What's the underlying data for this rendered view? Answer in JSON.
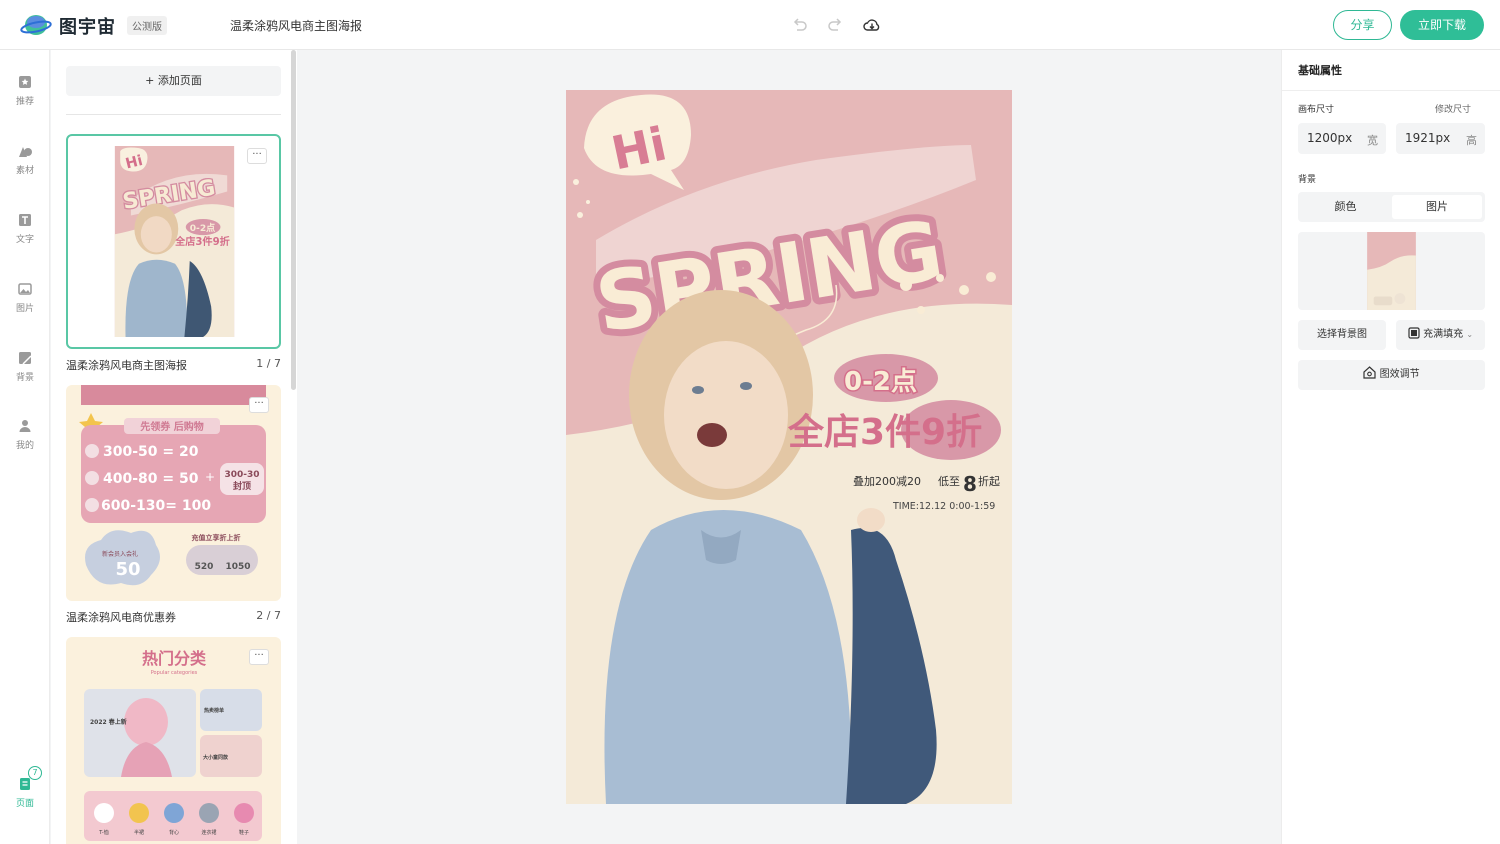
{
  "header": {
    "brand": "图宇宙",
    "badge": "公测版",
    "doc_title": "温柔涂鸦风电商主图海报",
    "share_label": "分享",
    "download_label": "立即下载"
  },
  "rail": {
    "items": [
      {
        "label": "推荐",
        "icon": "recommend-icon"
      },
      {
        "label": "素材",
        "icon": "shapes-icon"
      },
      {
        "label": "文字",
        "icon": "text-icon"
      },
      {
        "label": "图片",
        "icon": "image-icon"
      },
      {
        "label": "背景",
        "icon": "background-icon"
      },
      {
        "label": "我的",
        "icon": "user-icon"
      }
    ],
    "pages": {
      "label": "页面",
      "count": "7"
    }
  },
  "panel": {
    "add_page_label": "+ 添加页面",
    "pages": [
      {
        "caption": "温柔涂鸦风电商主图海报",
        "num": "1 / 7"
      },
      {
        "caption": "温柔涂鸦风电商优惠券",
        "num": "2 / 7"
      }
    ],
    "thumb1": {
      "hi": "Hi",
      "spring": "SPRING",
      "time": "0-2点",
      "offer": "全店3件9折"
    },
    "thumb2": {
      "ribbon": "先领券 后购物",
      "coupons": [
        "300-50 = 20",
        "400-80 = 50",
        "600-130= 100"
      ],
      "plus": "+",
      "cap": "300-30",
      "cap2": "封顶",
      "member": "新会员入会礼",
      "member_val": "50",
      "recharge": "充值立享折上折",
      "r1": "520",
      "r2": "1050"
    },
    "thumb3": {
      "title": "热门分类",
      "subtitle": "Popular categories",
      "tag": "2022 春上新",
      "tag2": "热卖榜单",
      "tag3": "大小童同款",
      "items": [
        "T-恤",
        "半裙",
        "背心",
        "连衣裙",
        "鞋子"
      ]
    }
  },
  "poster": {
    "hi": "Hi",
    "spring": "SPRING",
    "time": "0-2点",
    "offer": "全店3件9折",
    "stack": "叠加200减20",
    "low_prefix": "低至",
    "low_num": "8",
    "low_suffix": "折起",
    "time_range": "TIME:12.12 0:00-1:59"
  },
  "props": {
    "title": "基础属性",
    "canvas_size_label": "画布尺寸",
    "resize_label": "修改尺寸",
    "width_value": "1200px",
    "width_unit": "宽",
    "height_value": "1921px",
    "height_unit": "高",
    "bg_label": "背景",
    "tab_color": "颜色",
    "tab_image": "图片",
    "choose_bg_label": "选择背景图",
    "fill_label": "充满填充",
    "effect_label": "图效调节"
  },
  "colors": {
    "accent": "#2fbe97",
    "poster_pink": "#e6b8b8",
    "spring_pink": "#d98a9c",
    "cream": "#f6ecd9"
  }
}
